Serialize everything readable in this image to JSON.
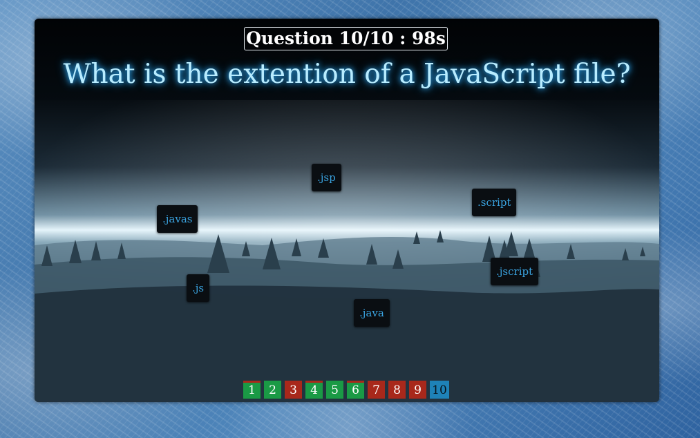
{
  "quiz": {
    "timer_text": "Question 10/10 : 98s",
    "question_text": "What is the extention of a JavaScript file?"
  },
  "answers": [
    {
      "label": ".jsp"
    },
    {
      "label": ".script"
    },
    {
      "label": ".javas"
    },
    {
      "label": ".jscript"
    },
    {
      "label": ".js"
    },
    {
      "label": ".java"
    }
  ],
  "progress": {
    "items": [
      {
        "label": "1",
        "status": "correct-after-incorrect"
      },
      {
        "label": "2",
        "status": "correct"
      },
      {
        "label": "3",
        "status": "incorrect"
      },
      {
        "label": "4",
        "status": "correct-after-incorrect"
      },
      {
        "label": "5",
        "status": "correct"
      },
      {
        "label": "6",
        "status": "correct-after-incorrect"
      },
      {
        "label": "7",
        "status": "incorrect"
      },
      {
        "label": "8",
        "status": "incorrect"
      },
      {
        "label": "9",
        "status": "incorrect"
      },
      {
        "label": "10",
        "status": "current"
      }
    ]
  },
  "colors": {
    "correct": "#1a9a45",
    "incorrect": "#a8281b",
    "current": "#1e82b8",
    "answer_text": "#3aa3e0",
    "question_glow": "#b8ecff"
  },
  "icons": {
    "background": "frost-texture",
    "scene": "snowy-forest-landscape"
  }
}
